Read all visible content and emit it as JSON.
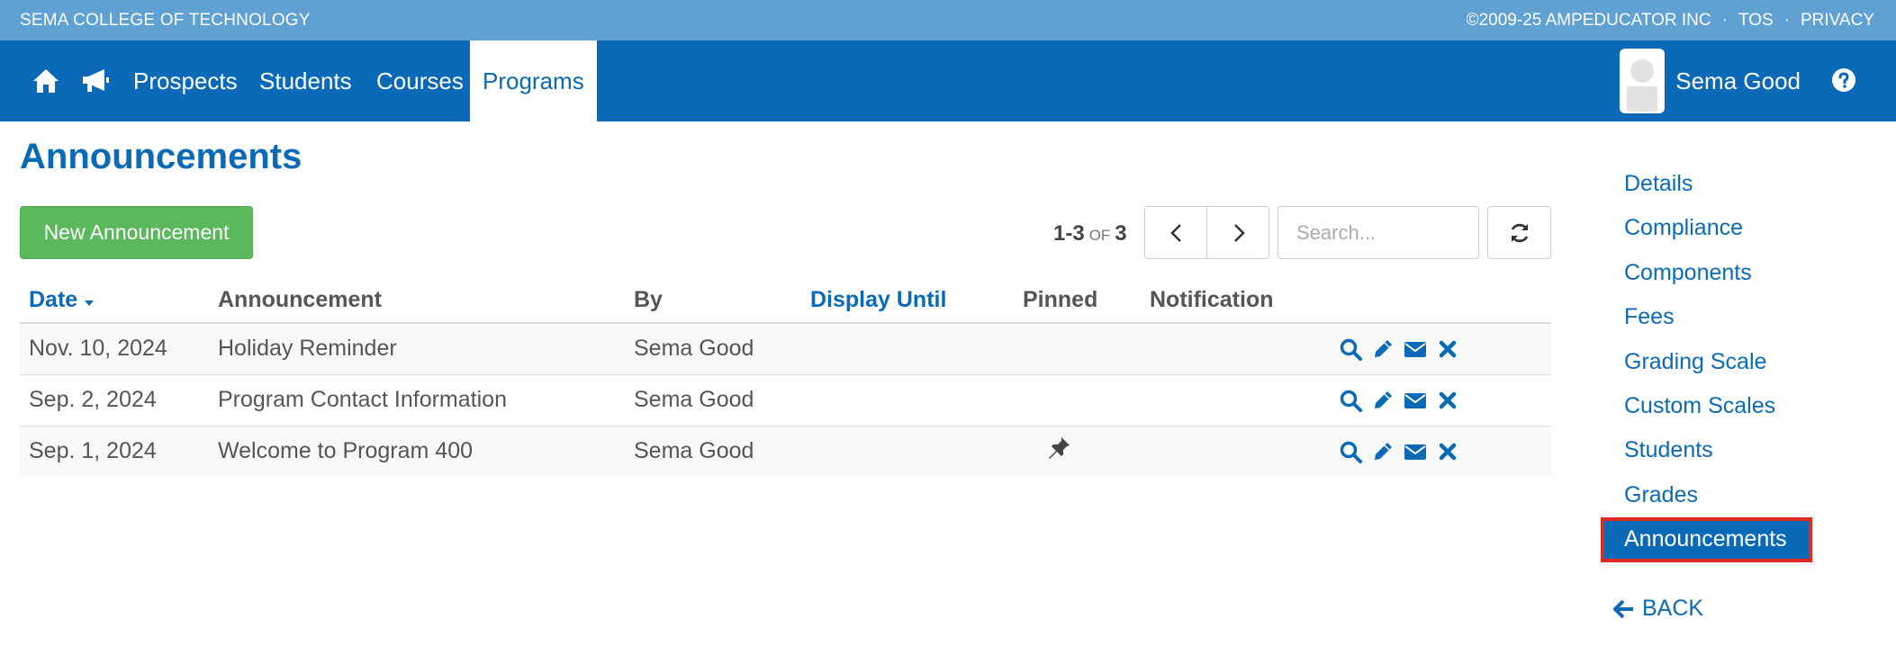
{
  "topbar": {
    "school": "SEMA COLLEGE OF TECHNOLOGY",
    "copyright": "©2009-25 AMPEDUCATOR INC",
    "separator": "·",
    "tos": "TOS",
    "privacy": "PRIVACY"
  },
  "nav": {
    "icons": [
      "home-icon",
      "megaphone-icon"
    ],
    "prospects": "Prospects",
    "students": "Students",
    "courses": "Courses",
    "programs": "Programs",
    "active": "Programs",
    "user_name": "Sema Good",
    "help_icon": "question-circle-icon"
  },
  "main": {
    "title": "Announcements",
    "new_button": "New Announcement",
    "pager": {
      "range": "1-3",
      "of": "of",
      "total": "3"
    },
    "search_placeholder": "Search...",
    "columns": {
      "date": "Date",
      "announcement": "Announcement",
      "by": "By",
      "display_until": "Display Until",
      "pinned": "Pinned",
      "notification": "Notification"
    },
    "rows": [
      {
        "date": "Nov. 10, 2024",
        "announcement": "Holiday Reminder",
        "by": "Sema Good",
        "display_until": "",
        "pinned": false,
        "notification": ""
      },
      {
        "date": "Sep. 2, 2024",
        "announcement": "Program Contact Information",
        "by": "Sema Good",
        "display_until": "",
        "pinned": false,
        "notification": ""
      },
      {
        "date": "Sep. 1, 2024",
        "announcement": "Welcome to Program 400",
        "by": "Sema Good",
        "display_until": "",
        "pinned": true,
        "notification": ""
      }
    ],
    "row_actions": [
      "search-icon",
      "pencil-icon",
      "envelope-icon",
      "times-icon"
    ]
  },
  "sidebar": {
    "items": [
      {
        "label": "Details"
      },
      {
        "label": "Compliance"
      },
      {
        "label": "Components"
      },
      {
        "label": "Fees"
      },
      {
        "label": "Grading Scale"
      },
      {
        "label": "Custom Scales"
      },
      {
        "label": "Students"
      },
      {
        "label": "Grades"
      },
      {
        "label": "Announcements"
      }
    ],
    "active": "Announcements",
    "back": "BACK"
  },
  "colors": {
    "primary": "#0a6ab7",
    "topbar": "#5fa1d2",
    "success": "#5cb85c",
    "highlight_border": "#e02a1e"
  }
}
